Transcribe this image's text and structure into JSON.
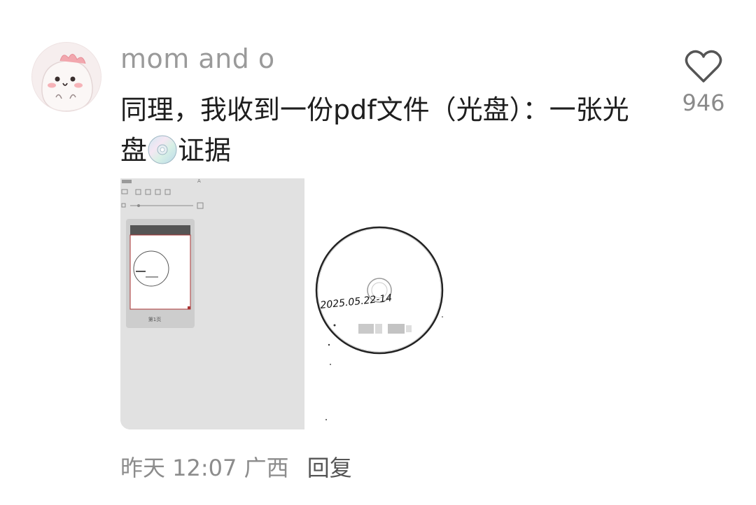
{
  "comment": {
    "username": "mom and o",
    "text_line1": "同理，我收到一份pdf文件（光盘）：一张光盘",
    "text_line2": "证据",
    "likes": "946",
    "time": "昨天 12:07",
    "location": "广西",
    "reply_label": "回复"
  },
  "images": {
    "viewer_page_label": "第1页",
    "disc_date": "2025.05.22-14"
  }
}
